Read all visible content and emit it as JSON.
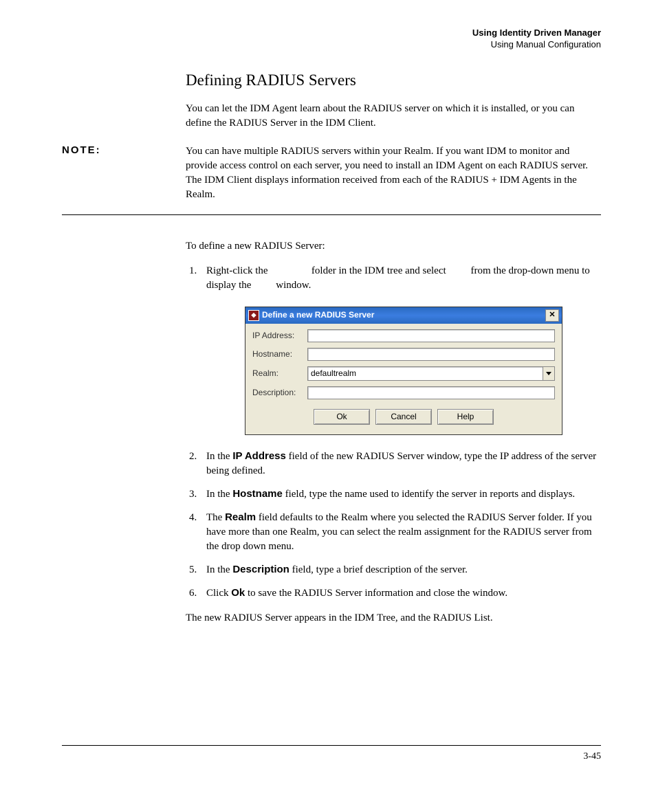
{
  "header": {
    "line1": "Using Identity Driven Manager",
    "line2": "Using Manual Configuration"
  },
  "title": "Defining RADIUS Servers",
  "intro": "You can let the IDM Agent learn about the RADIUS server on which it is installed, or you can define the RADIUS Server in the IDM Client.",
  "note": {
    "label": "NOTE:",
    "text": "You can have multiple RADIUS servers within your Realm. If you want IDM to monitor and provide access control on each server, you need to install an IDM Agent on each RADIUS server. The IDM Client displays information received from each of the RADIUS + IDM Agents in the Realm."
  },
  "lead": "To define a new RADIUS Server:",
  "steps": {
    "s1a": "Right-click the ",
    "s1b": " folder in the IDM tree and select ",
    "s1c": " from the drop-down menu to display the ",
    "s1d": " window.",
    "s2a": "In the ",
    "s2b_bold": "IP Address",
    "s2c": " field of the new RADIUS Server window, type the IP address of the server being defined.",
    "s3a": "In the ",
    "s3b_bold": "Hostname",
    "s3c": " field, type the name used to identify the server in reports and displays.",
    "s4a": "The ",
    "s4b_bold": "Realm",
    "s4c": " field defaults to the Realm where you selected the RADIUS Server folder. If you have more than one Realm, you can select the realm assignment for the RADIUS server from the drop down menu.",
    "s5a": "In the ",
    "s5b_bold": "Description",
    "s5c": " field, type a brief description of the server.",
    "s6a": "Click ",
    "s6b_bold": "Ok",
    "s6c": " to save the RADIUS Server information and close the window."
  },
  "closing": "The new RADIUS Server appears in the IDM Tree, and the RADIUS List.",
  "dialog": {
    "title": "Define a new RADIUS Server",
    "labels": {
      "ip": "IP Address:",
      "host": "Hostname:",
      "realm": "Realm:",
      "desc": "Description:"
    },
    "realm_value": "defaultrealm",
    "buttons": {
      "ok": "Ok",
      "cancel": "Cancel",
      "help": "Help"
    }
  },
  "page_number": "3-45"
}
